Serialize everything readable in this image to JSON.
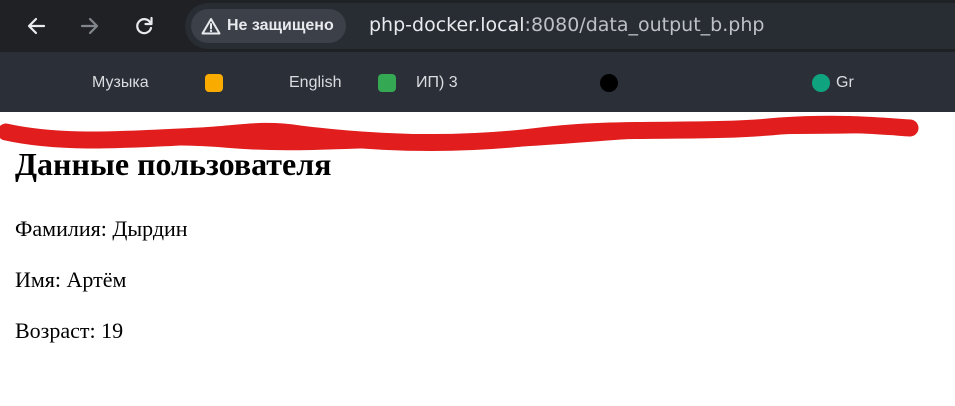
{
  "browser": {
    "security_label": "Не защищено",
    "url_host": "php-docker.local",
    "url_rest": ":8080/data_output_b.php",
    "bookmarks": [
      {
        "label": "Музыка",
        "icon_color": "#e8eaed"
      },
      {
        "label": "English",
        "icon_color": "#f9ab00"
      },
      {
        "label": "ИП) 3",
        "icon_color": "#34a853"
      },
      {
        "label": "",
        "icon_color": "#000000"
      },
      {
        "label": "Gr",
        "icon_color": "#10a37f"
      }
    ],
    "redaction_color": "#e11d1d"
  },
  "page": {
    "heading": "Данные пользователя",
    "fields": [
      "Фамилия: Дырдин",
      "Имя: Артём",
      "Возраст: 19"
    ]
  }
}
